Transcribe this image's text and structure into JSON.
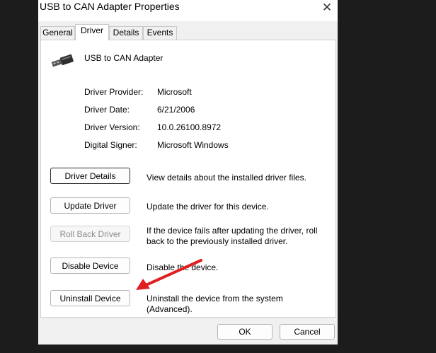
{
  "window": {
    "title": "USB to CAN Adapter Properties"
  },
  "tabs": [
    {
      "label": "General"
    },
    {
      "label": "Driver"
    },
    {
      "label": "Details"
    },
    {
      "label": "Events"
    }
  ],
  "active_tab": "Driver",
  "device": {
    "name": "USB to CAN Adapter",
    "icon": "usb-plug-icon"
  },
  "info": [
    {
      "label": "Driver Provider:",
      "value": "Microsoft"
    },
    {
      "label": "Driver Date:",
      "value": "6/21/2006"
    },
    {
      "label": "Driver Version:",
      "value": "10.0.26100.8972"
    },
    {
      "label": "Digital Signer:",
      "value": "Microsoft Windows"
    }
  ],
  "actions": [
    {
      "label": "Driver Details",
      "description": "View details about the installed driver files."
    },
    {
      "label": "Update Driver",
      "description": "Update the driver for this device."
    },
    {
      "label": "Roll Back Driver",
      "description": "If the device fails after updating the driver, roll back to the previously installed driver."
    },
    {
      "label": "Disable Device",
      "description": "Disable the device."
    },
    {
      "label": "Uninstall Device",
      "description": "Uninstall the device from the system (Advanced)."
    }
  ],
  "footer": {
    "ok_label": "OK",
    "cancel_label": "Cancel"
  },
  "annotation": {
    "color": "#e02020"
  }
}
